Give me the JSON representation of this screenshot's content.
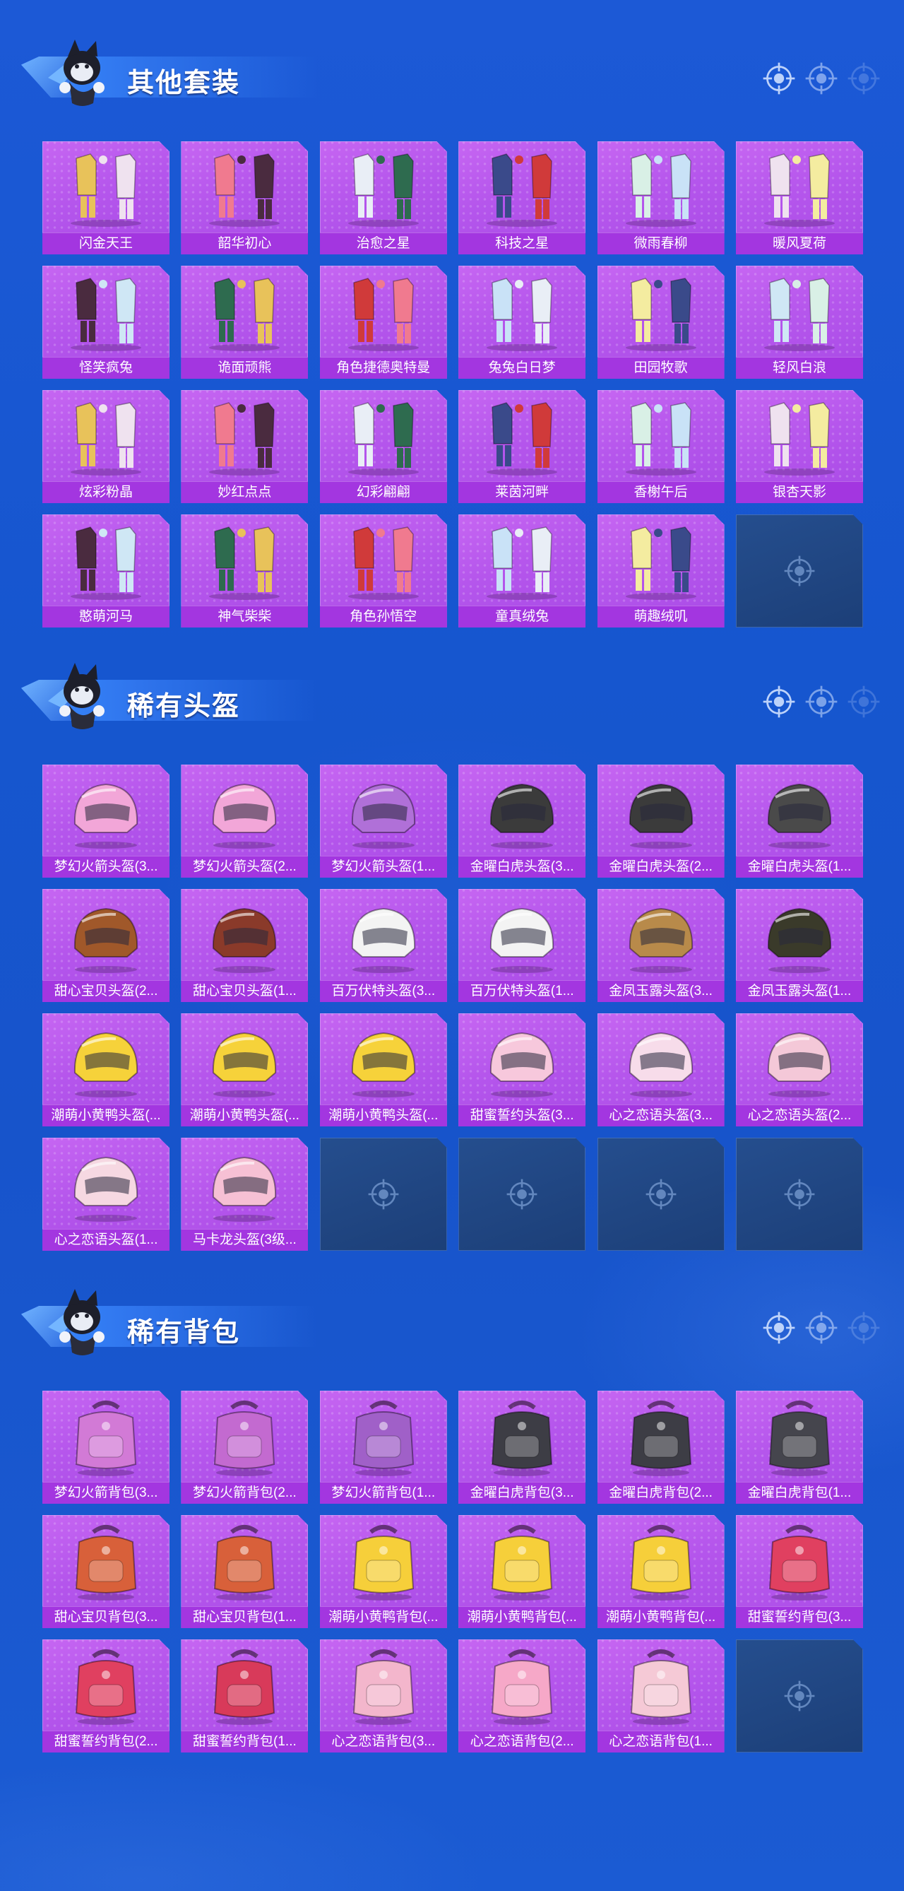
{
  "colors": {
    "background": "#1656cf",
    "card": "#b556ec",
    "label_bar": "#a336e0",
    "empty_slot": "#204784"
  },
  "sections": [
    {
      "title": "其他套装",
      "kind": "outfit",
      "items": [
        "闪金天王",
        "韶华初心",
        "治愈之星",
        "科技之星",
        "微雨春柳",
        "暖风夏荷",
        "怪笑疯兔",
        "诡面顽熊",
        "角色捷德奥特曼",
        "兔兔白日梦",
        "田园牧歌",
        "轻风白浪",
        "炫彩粉晶",
        "妙红点点",
        "幻彩翩翩",
        "莱茵河畔",
        "香榭午后",
        "银杏天影",
        "憨萌河马",
        "神气柴柴",
        "角色孙悟空",
        "童真绒兔",
        "萌趣绒叽"
      ],
      "empty_slots": 1
    },
    {
      "title": "稀有头盔",
      "kind": "helmet",
      "items": [
        "梦幻火箭头盔(3...",
        "梦幻火箭头盔(2...",
        "梦幻火箭头盔(1...",
        "金曜白虎头盔(3...",
        "金曜白虎头盔(2...",
        "金曜白虎头盔(1...",
        "甜心宝贝头盔(2...",
        "甜心宝贝头盔(1...",
        "百万伏特头盔(3...",
        "百万伏特头盔(1...",
        "金凤玉露头盔(3...",
        "金凤玉露头盔(1...",
        "潮萌小黄鸭头盔(...",
        "潮萌小黄鸭头盔(...",
        "潮萌小黄鸭头盔(...",
        "甜蜜誓约头盔(3...",
        "心之恋语头盔(3...",
        "心之恋语头盔(2...",
        "心之恋语头盔(1...",
        "马卡龙头盔(3级..."
      ],
      "empty_slots": 4
    },
    {
      "title": "稀有背包",
      "kind": "backpack",
      "items": [
        "梦幻火箭背包(3...",
        "梦幻火箭背包(2...",
        "梦幻火箭背包(1...",
        "金曜白虎背包(3...",
        "金曜白虎背包(2...",
        "金曜白虎背包(1...",
        "甜心宝贝背包(3...",
        "甜心宝贝背包(1...",
        "潮萌小黄鸭背包(...",
        "潮萌小黄鸭背包(...",
        "潮萌小黄鸭背包(...",
        "甜蜜誓约背包(3...",
        "甜蜜誓约背包(2...",
        "甜蜜誓约背包(1...",
        "心之恋语背包(3...",
        "心之恋语背包(2...",
        "心之恋语背包(1..."
      ],
      "empty_slots": 1
    }
  ],
  "icons": {
    "section_mascot": "mascot-icon",
    "section_decoration": "crosshair-icon",
    "empty_slot": "crosshair-icon"
  }
}
